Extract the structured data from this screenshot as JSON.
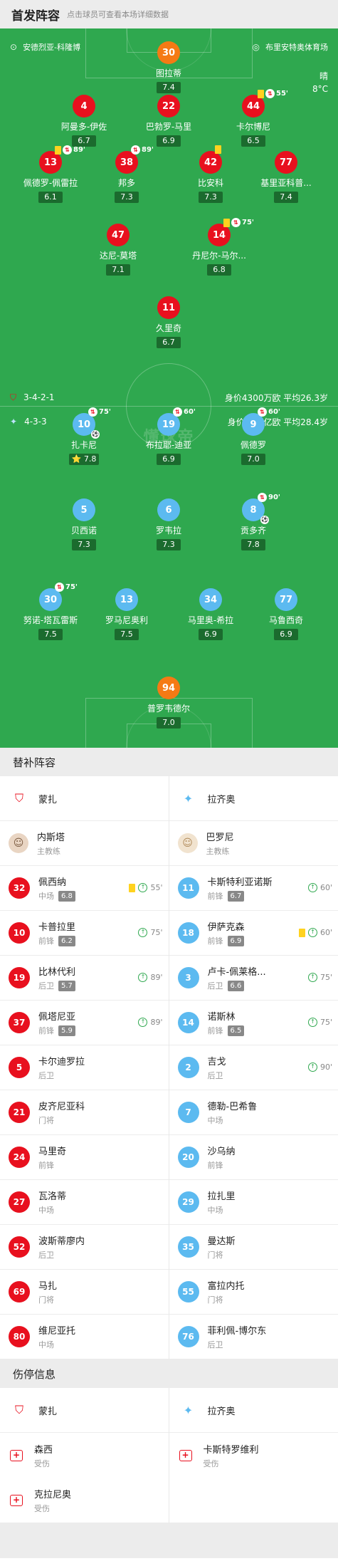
{
  "header": {
    "title": "首发阵容",
    "hint": "点击球员可查看本场详细数据"
  },
  "match": {
    "home_coach_label": "安德烈亚-科隆博",
    "venue": "布里安特奥体育场",
    "weather": "晴",
    "temperature": "8°C"
  },
  "home": {
    "formation": "3-4-2-1",
    "value_text": "身价4300万欧 平均26.3岁",
    "color": "#e8101e"
  },
  "away": {
    "formation": "4-3-3",
    "value_text": "身价1.49亿欧 平均28.4岁",
    "color": "#5cbaf0"
  },
  "watermark": "懂球帝",
  "home_players": [
    {
      "num": "30",
      "name": "图拉蒂",
      "rating": "7.4",
      "gk": true
    },
    {
      "num": "4",
      "name": "阿曼多-伊佐",
      "rating": "6.7"
    },
    {
      "num": "22",
      "name": "巴勃罗-马里",
      "rating": "6.9"
    },
    {
      "num": "44",
      "name": "卡尔博尼",
      "rating": "6.5",
      "yellow": true,
      "sub": "55'"
    },
    {
      "num": "13",
      "name": "佩德罗-佩雷拉",
      "rating": "6.1",
      "yellow": true,
      "sub": "89'"
    },
    {
      "num": "38",
      "name": "邦多",
      "rating": "7.3",
      "sub": "89'"
    },
    {
      "num": "42",
      "name": "比安科",
      "rating": "7.3",
      "yellow": true
    },
    {
      "num": "77",
      "name": "基里亚科普...",
      "rating": "7.4"
    },
    {
      "num": "47",
      "name": "达尼-莫塔",
      "rating": "7.1"
    },
    {
      "num": "14",
      "name": "丹尼尔-马尔...",
      "rating": "6.8",
      "yellow": true,
      "sub": "75'"
    },
    {
      "num": "11",
      "name": "久里奇",
      "rating": "6.7"
    }
  ],
  "away_players": [
    {
      "num": "10",
      "name": "扎卡尼",
      "rating": "7.8",
      "sub": "75'",
      "goal": true,
      "star": "⭐"
    },
    {
      "num": "19",
      "name": "布拉耶-迪亚",
      "rating": "6.9",
      "sub": "60'"
    },
    {
      "num": "9",
      "name": "佩德罗",
      "rating": "7.0",
      "sub": "60'"
    },
    {
      "num": "5",
      "name": "贝西诺",
      "rating": "7.3"
    },
    {
      "num": "6",
      "name": "罗韦拉",
      "rating": "7.3"
    },
    {
      "num": "8",
      "name": "贡多齐",
      "rating": "7.8",
      "sub": "90'",
      "goal": true
    },
    {
      "num": "30",
      "name": "努诺-塔瓦雷斯",
      "rating": "7.5",
      "sub": "75'"
    },
    {
      "num": "13",
      "name": "罗马尼奥利",
      "rating": "7.5"
    },
    {
      "num": "34",
      "name": "马里奥-希拉",
      "rating": "6.9"
    },
    {
      "num": "77",
      "name": "马鲁西奇",
      "rating": "6.9"
    },
    {
      "num": "94",
      "name": "普罗韦德尔",
      "rating": "7.0",
      "gk": true
    }
  ],
  "subs": {
    "title": "替补阵容",
    "home_team": "蒙扎",
    "away_team": "拉齐奥",
    "home_coach": {
      "name": "内斯塔",
      "role": "主教练"
    },
    "away_coach": {
      "name": "巴罗尼",
      "role": "主教练"
    },
    "home": [
      {
        "num": "32",
        "name": "佩西纳",
        "pos": "中场",
        "rating": "6.8",
        "yellow": true,
        "in": "55'"
      },
      {
        "num": "10",
        "name": "卡普拉里",
        "pos": "前锋",
        "rating": "6.2",
        "in": "75'"
      },
      {
        "num": "19",
        "name": "比林代利",
        "pos": "后卫",
        "rating": "5.7",
        "in": "89'"
      },
      {
        "num": "37",
        "name": "佩塔尼亚",
        "pos": "前锋",
        "rating": "5.9",
        "in": "89'"
      },
      {
        "num": "5",
        "name": "卡尔迪罗拉",
        "pos": "后卫"
      },
      {
        "num": "21",
        "name": "皮齐尼亚科",
        "pos": "门将"
      },
      {
        "num": "24",
        "name": "马里奇",
        "pos": "前锋"
      },
      {
        "num": "27",
        "name": "瓦洛蒂",
        "pos": "中场"
      },
      {
        "num": "52",
        "name": "波斯蒂廖内",
        "pos": "后卫"
      },
      {
        "num": "69",
        "name": "马扎",
        "pos": "门将"
      },
      {
        "num": "80",
        "name": "维尼亚托",
        "pos": "中场"
      }
    ],
    "away": [
      {
        "num": "11",
        "name": "卡斯特利亚诺斯",
        "pos": "前锋",
        "rating": "6.7",
        "in": "60'"
      },
      {
        "num": "18",
        "name": "伊萨克森",
        "pos": "前锋",
        "rating": "6.9",
        "yellow": true,
        "in": "60'"
      },
      {
        "num": "3",
        "name": "卢卡-佩莱格...",
        "pos": "后卫",
        "rating": "6.6",
        "in": "75'"
      },
      {
        "num": "14",
        "name": "诺斯林",
        "pos": "前锋",
        "rating": "6.5",
        "in": "75'"
      },
      {
        "num": "2",
        "name": "吉戈",
        "pos": "后卫",
        "in": "90'"
      },
      {
        "num": "7",
        "name": "德勒-巴希鲁",
        "pos": "中场"
      },
      {
        "num": "20",
        "name": "沙乌纳",
        "pos": "前锋"
      },
      {
        "num": "29",
        "name": "拉扎里",
        "pos": "中场"
      },
      {
        "num": "35",
        "name": "曼达斯",
        "pos": "门将"
      },
      {
        "num": "55",
        "name": "富拉内托",
        "pos": "门将"
      },
      {
        "num": "76",
        "name": "菲利佩-博尔东",
        "pos": "后卫"
      }
    ]
  },
  "injuries": {
    "title": "伤停信息",
    "home_team": "蒙扎",
    "away_team": "拉齐奥",
    "home": [
      {
        "name": "森西",
        "status": "受伤"
      },
      {
        "name": "克拉尼奥",
        "status": "受伤"
      }
    ],
    "away": [
      {
        "name": "卡斯特罗维利",
        "status": "受伤"
      }
    ]
  }
}
